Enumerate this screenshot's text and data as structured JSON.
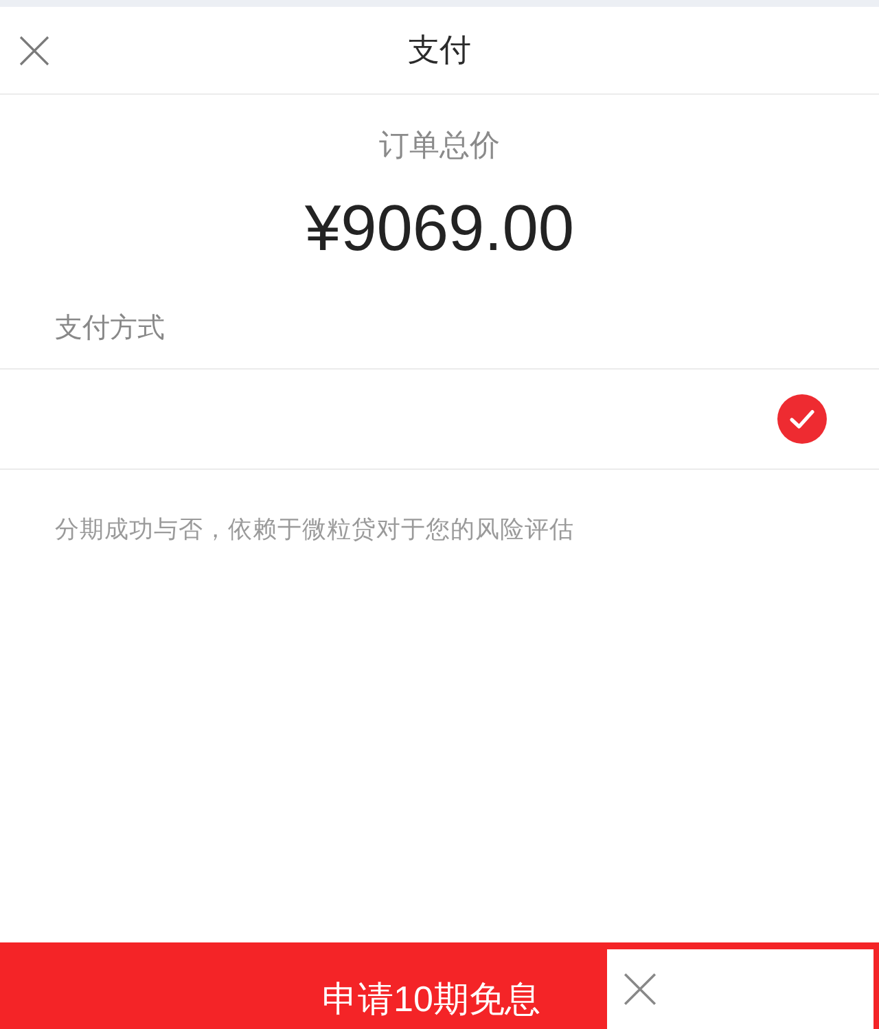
{
  "top_bar": {
    "title": "支付"
  },
  "order": {
    "label": "订单总价",
    "amount": "¥9069.00"
  },
  "payment": {
    "label": "支付方式",
    "methods": [
      {
        "selected": true
      }
    ]
  },
  "note": "分期成功与否，依赖于微粒贷对于您的风险评估",
  "footer": {
    "button": "申请10期免息"
  }
}
